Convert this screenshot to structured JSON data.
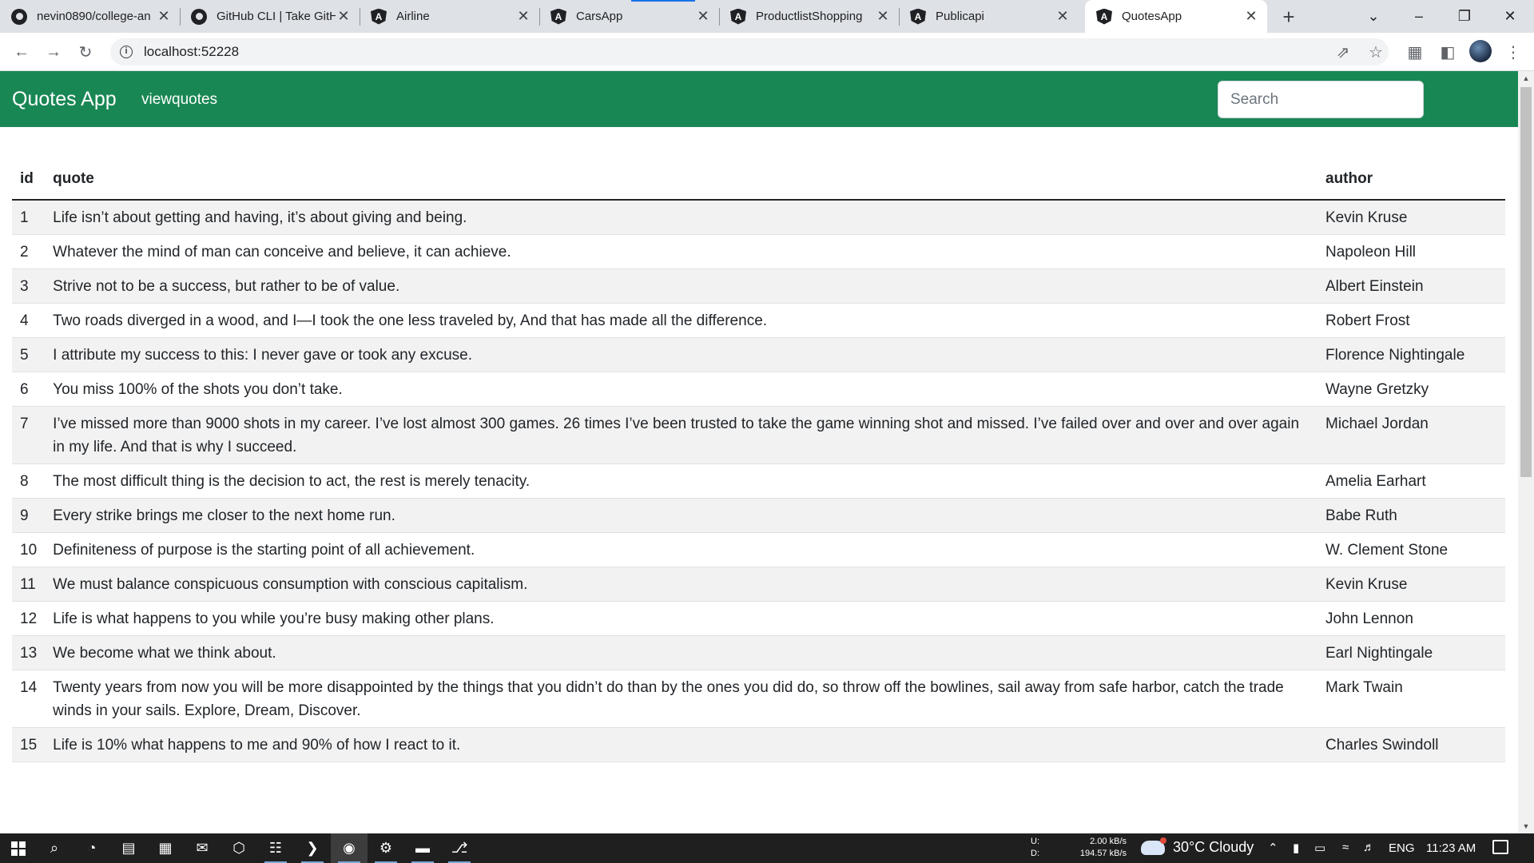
{
  "browser": {
    "tabs": [
      {
        "title": "nevin0890/college-an",
        "icon": "github-icon"
      },
      {
        "title": "GitHub CLI | Take GitH",
        "icon": "github-icon"
      },
      {
        "title": "Airline",
        "icon": "angular-icon"
      },
      {
        "title": "CarsApp",
        "icon": "angular-icon"
      },
      {
        "title": "ProductlistShopping",
        "icon": "angular-icon"
      },
      {
        "title": "Publicapi",
        "icon": "angular-icon"
      },
      {
        "title": "QuotesApp",
        "icon": "angular-icon"
      }
    ],
    "active_tab_index": 6,
    "url": "localhost:52228"
  },
  "app": {
    "brand": "Quotes App",
    "nav_link": "viewquotes",
    "search": {
      "placeholder": "Search",
      "value": ""
    },
    "accent_color": "#198754"
  },
  "table": {
    "headers": [
      "id",
      "quote",
      "author"
    ],
    "rows": [
      {
        "id": "1",
        "quote": "Life isn’t about getting and having, it’s about giving and being.",
        "author": "Kevin Kruse"
      },
      {
        "id": "2",
        "quote": "Whatever the mind of man can conceive and believe, it can achieve.",
        "author": "Napoleon Hill"
      },
      {
        "id": "3",
        "quote": "Strive not to be a success, but rather to be of value.",
        "author": "Albert Einstein"
      },
      {
        "id": "4",
        "quote": "Two roads diverged in a wood, and I—I took the one less traveled by, And that has made all the difference.",
        "author": "Robert Frost"
      },
      {
        "id": "5",
        "quote": "I attribute my success to this: I never gave or took any excuse.",
        "author": "Florence Nightingale"
      },
      {
        "id": "6",
        "quote": "You miss 100% of the shots you don’t take.",
        "author": "Wayne Gretzky"
      },
      {
        "id": "7",
        "quote": "I’ve missed more than 9000 shots in my career. I’ve lost almost 300 games. 26 times I’ve been trusted to take the game winning shot and missed. I’ve failed over and over and over again in my life. And that is why I succeed.",
        "author": "Michael Jordan"
      },
      {
        "id": "8",
        "quote": "The most difficult thing is the decision to act, the rest is merely tenacity.",
        "author": "Amelia Earhart"
      },
      {
        "id": "9",
        "quote": "Every strike brings me closer to the next home run.",
        "author": "Babe Ruth"
      },
      {
        "id": "10",
        "quote": "Definiteness of purpose is the starting point of all achievement.",
        "author": "W. Clement Stone"
      },
      {
        "id": "11",
        "quote": "We must balance conspicuous consumption with conscious capitalism.",
        "author": "Kevin Kruse"
      },
      {
        "id": "12",
        "quote": "Life is what happens to you while you’re busy making other plans.",
        "author": "John Lennon"
      },
      {
        "id": "13",
        "quote": "We become what we think about.",
        "author": "Earl Nightingale"
      },
      {
        "id": "14",
        "quote": "Twenty years from now you will be more disappointed by the things that you didn’t do than by the ones you did do, so throw off the bowlines, sail away from safe harbor, catch the trade winds in your sails. Explore, Dream, Discover.",
        "author": "Mark Twain"
      },
      {
        "id": "15",
        "quote": "Life is 10% what happens to me and 90% of how I react to it.",
        "author": "Charles Swindoll"
      }
    ]
  },
  "taskbar": {
    "apps": [
      "search-icon",
      "edge-icon",
      "file-explorer-icon",
      "store-icon",
      "mail-icon",
      "vpn-icon",
      "teams-icon",
      "vscode-icon",
      "chrome-icon",
      "settings-icon",
      "terminal-icon",
      "git-icon"
    ],
    "net_upload_label": "U:",
    "net_upload": "2.00 kB/s",
    "net_download_label": "D:",
    "net_download": "194.57 kB/s",
    "weather": "30°C  Cloudy",
    "language": "ENG",
    "time": "11:23 AM"
  }
}
